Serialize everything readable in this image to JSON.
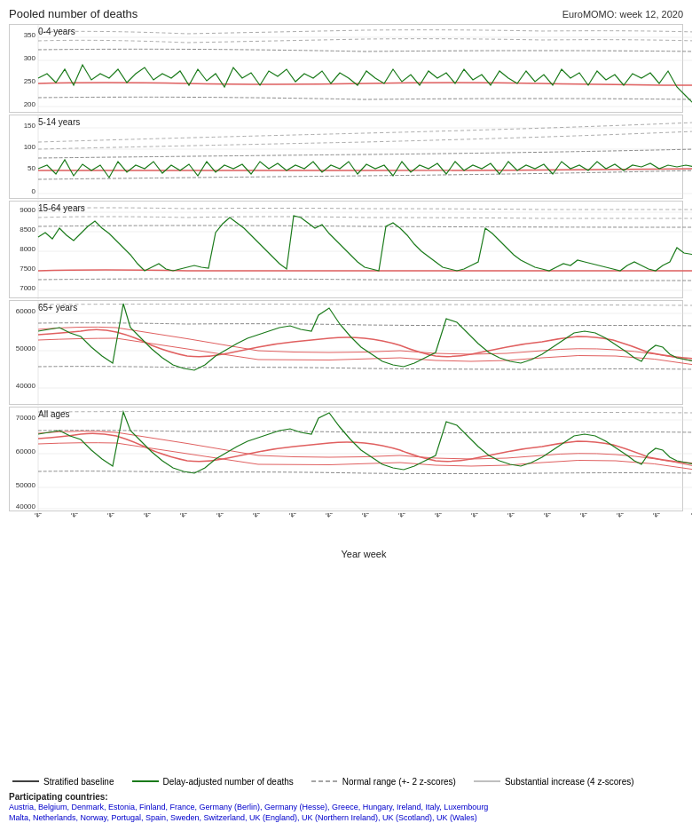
{
  "header": {
    "title": "Pooled number of deaths",
    "subtitle": "EuroMOMO: week 12, 2020"
  },
  "charts": [
    {
      "id": "chart-0-4",
      "label": "0-4 years",
      "yMin": 200,
      "yMax": 350,
      "yTicks": [
        "350",
        "300",
        "250",
        "200"
      ],
      "height": 100
    },
    {
      "id": "chart-5-14",
      "label": "5-14 years",
      "yMin": 0,
      "yMax": 150,
      "yTicks": [
        "150",
        "100",
        "50",
        "0"
      ],
      "height": 95
    },
    {
      "id": "chart-15-64",
      "label": "15-64 years",
      "yMin": 7000,
      "yMax": 9000,
      "yTicks": [
        "9000",
        "8500",
        "8000",
        "7500",
        "7000"
      ],
      "height": 110
    },
    {
      "id": "chart-65plus",
      "label": "65+ years",
      "yMin": 35000,
      "yMax": 62000,
      "yTicks": [
        "60000",
        "50000",
        "40000"
      ],
      "height": 120
    },
    {
      "id": "chart-all",
      "label": "All ages",
      "yMin": 40000,
      "yMax": 72000,
      "yTicks": [
        "70000",
        "60000",
        "50000",
        "40000"
      ],
      "height": 120
    }
  ],
  "xTicks": [
    "2016-04",
    "2016-16",
    "2016-28",
    "2016-40",
    "2016-52",
    "2017-12",
    "2017-24",
    "2017-36",
    "2017-48",
    "2018-08",
    "2018-20",
    "2018-32",
    "2018-44",
    "2019-04",
    "2019-16",
    "2019-28",
    "2019-40",
    "2019-52",
    "2020-12"
  ],
  "xAxisLabel": "Year week",
  "legend": [
    {
      "label": "Stratified baseline",
      "style": "solid",
      "color": "#000"
    },
    {
      "label": "Delay-adjusted number of deaths",
      "style": "solid",
      "color": "#1a7a1a"
    },
    {
      "label": "Normal range (+- 2 z-scores)",
      "style": "dashed",
      "color": "#888"
    },
    {
      "label": "Substantial increase (4 z-scores)",
      "style": "solid-thin",
      "color": "#aaa"
    }
  ],
  "participating": {
    "title": "Participating countries:",
    "text": "Austria, Belgium, Denmark, Estonia, Finland, France, Germany (Berlin), Germany (Hesse), Greece, Hungary, Ireland, Italy, Luxembourg\nMalta, Netherlands, Norway, Portugal, Spain, Sweden, Switzerland, UK (England), UK (Northern Ireland), UK (Scotland), UK (Wales)"
  }
}
